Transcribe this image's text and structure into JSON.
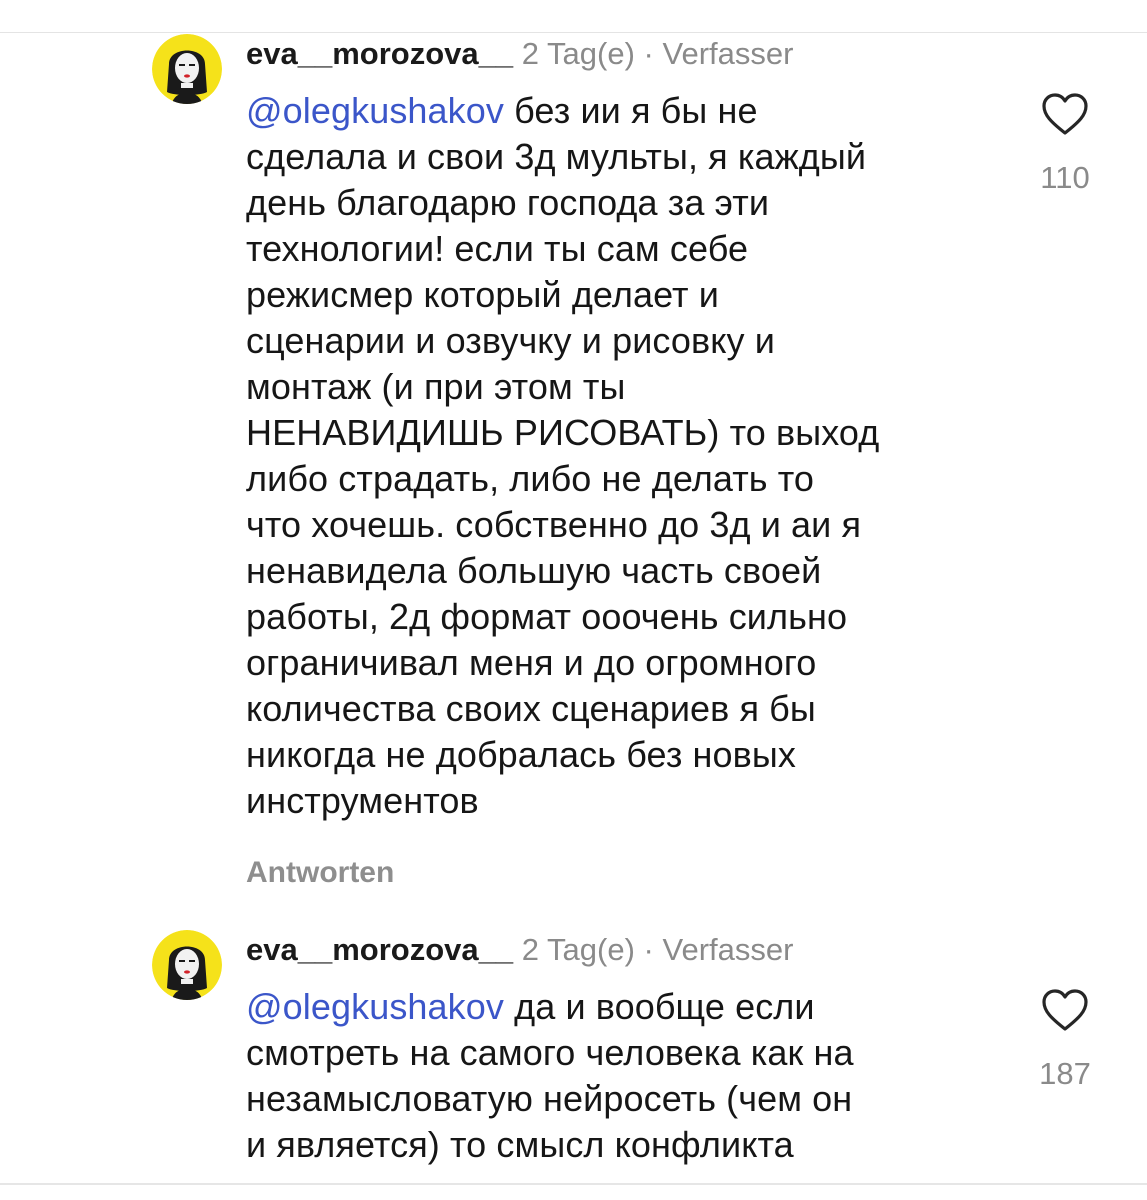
{
  "comments": [
    {
      "username": "eva__morozova__",
      "time": "2 Tag(e)",
      "separator": "·",
      "badge": "Verfasser",
      "likes": "110",
      "reply_label": "Antworten",
      "avatar_icon": "woman-portrait-avatar",
      "lines": [
        "без ии я бы не",
        "сделала и свои 3д мульты, я каждый",
        "день благодарю господа за эти",
        "технологии! если ты сам себе",
        "режисмер который делает и",
        "сценарии и озвучку и рисовку и",
        "монтаж (и при этом ты",
        "НЕНАВИДИШЬ РИСОВАТЬ) то выход",
        "либо страдать, либо не делать то",
        "что хочешь. собственно до 3д и аи я",
        "ненавидела большую часть своей",
        "работы, 2д формат ооочень сильно",
        "ограничивал меня и до огромного",
        "количества своих сценариев я бы",
        "никогда не добралась без новых",
        "инструментов"
      ],
      "mention": "@olegkushakov"
    },
    {
      "username": "eva__morozova__",
      "time": "2 Tag(e)",
      "separator": "·",
      "badge": "Verfasser",
      "likes": "187",
      "avatar_icon": "woman-portrait-avatar",
      "lines": [
        "да и вообще если",
        "смотреть на самого человека как на",
        "незамысловатую нейросеть (чем он",
        "и является) то смысл конфликта"
      ],
      "mention": "@olegkushakov"
    }
  ],
  "colors": {
    "mention": "#3b56c9",
    "muted": "#8a8a8a",
    "avatar_bg": "#f5e21a"
  }
}
